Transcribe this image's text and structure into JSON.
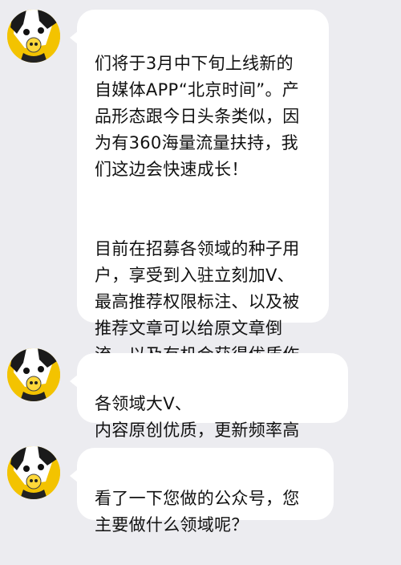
{
  "messages": [
    {
      "paragraphs": [
        "们将于3月中下旬上线新的\n自媒体APP“北京时间”。产\n品形态跟今日头条类似，因\n为有360海量流量扶持，我\n们这边会快速成长！",
        "目前在招募各领域的种子用\n户，享受到入驻立刻加V、\n最高推荐权限标注、以及被\n推荐文章可以给原文章倒\n流、以及有机会获得优质作\n者的稿费扶持资金！"
      ]
    },
    {
      "paragraphs": [
        "各领域大V、\n内容原创优质，更新频率高"
      ]
    },
    {
      "paragraphs": [
        "看了一下您做的公众号，您\n主要做什么领域呢？"
      ]
    }
  ],
  "colors": {
    "background": "#ececf0",
    "bubble": "#ffffff",
    "avatar_accent": "#f3c300"
  },
  "icons": {
    "avatar": "dog-avatar-icon"
  }
}
